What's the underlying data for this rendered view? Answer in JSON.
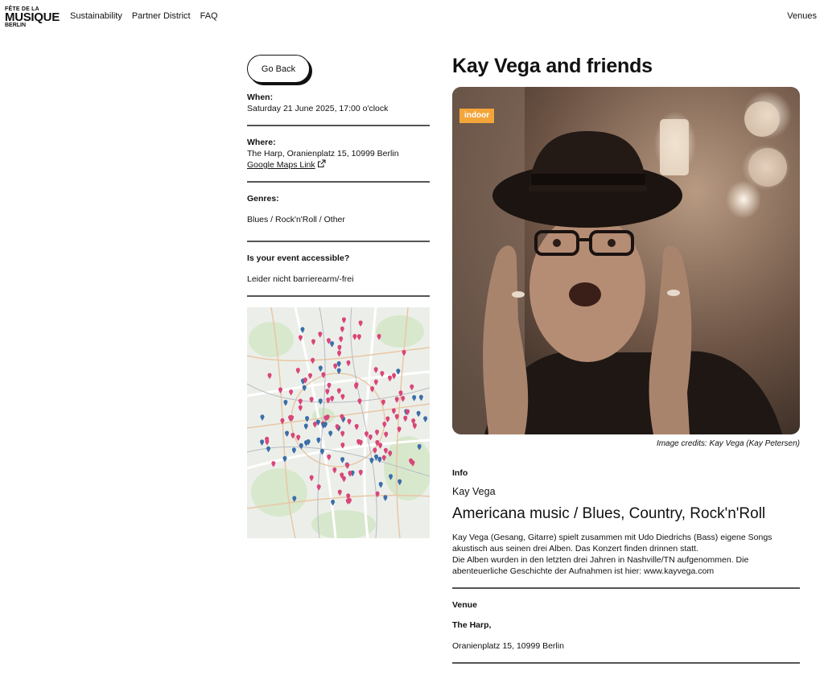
{
  "header": {
    "logo": {
      "line1": "FÊTE DE LA",
      "line2": "MUSIQUE",
      "line3": "BERLIN"
    },
    "nav": [
      "Sustainability",
      "Partner District",
      "FAQ"
    ],
    "venues": "Venues"
  },
  "event": {
    "go_back": "Go Back",
    "when_label": "When:",
    "when_value": "Saturday 21 June 2025, 17:00 o'clock",
    "where_label": "Where:",
    "where_value": "The Harp, Oranienplatz 15, 10999 Berlin",
    "maps_link": "Google Maps Link",
    "genres_label": "Genres:",
    "genres_value": "Blues / Rock'n'Roll / Other",
    "access_label": "Is your event accessible?",
    "access_value": "Leider nicht barrierearm/-frei",
    "title": "Kay Vega and friends",
    "badge": "indoor",
    "credits": "Image credits: Kay Vega (Kay Petersen)",
    "info_label": "Info",
    "artist": "Kay Vega",
    "genre_headline": "Americana music / Blues, Country, Rock'n'Roll",
    "description": [
      "Kay Vega (Gesang, Gitarre) spielt zusammen mit Udo Diedrichs (Bass) eigene Songs",
      "akustisch aus seinen drei Alben. Das Konzert finden drinnen statt.",
      "Die Alben wurden in den letzten drei Jahren in Nashville/TN aufgenommen. Die",
      "abenteuerliche Geschichte der Aufnahmen ist hier: www.kayvega.com"
    ],
    "venue_label": "Venue",
    "venue_name": "The Harp,",
    "venue_address": "Oranienplatz 15, 10999 Berlin"
  },
  "colors": {
    "badge": "#f4a53a",
    "divider": "#555555",
    "map_pin_pink": "#d9467a",
    "map_pin_blue": "#3c6ea8"
  }
}
